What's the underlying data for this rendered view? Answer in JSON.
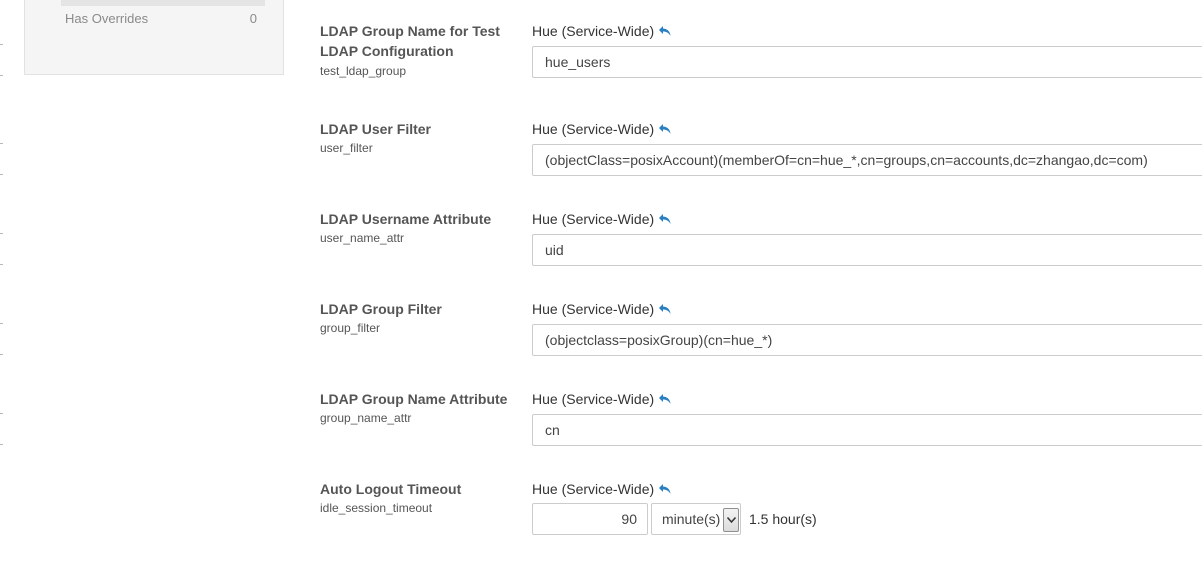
{
  "sidebar": {
    "filter_label": "Has Overrides",
    "filter_count": "0"
  },
  "rows": [
    {
      "title": "LDAP Group Name for Test LDAP Configuration",
      "key": "test_ldap_group",
      "scope": "Hue (Service-Wide)",
      "value": "hue_users"
    },
    {
      "title": "LDAP User Filter",
      "key": "user_filter",
      "scope": "Hue (Service-Wide)",
      "value": "(objectClass=posixAccount)(memberOf=cn=hue_*,cn=groups,cn=accounts,dc=zhangao,dc=com)"
    },
    {
      "title": "LDAP Username Attribute",
      "key": "user_name_attr",
      "scope": "Hue (Service-Wide)",
      "value": "uid"
    },
    {
      "title": "LDAP Group Filter",
      "key": "group_filter",
      "scope": "Hue (Service-Wide)",
      "value": "(objectclass=posixGroup)(cn=hue_*)"
    },
    {
      "title": "LDAP Group Name Attribute",
      "key": "group_name_attr",
      "scope": "Hue (Service-Wide)",
      "value": "cn"
    },
    {
      "title": "Auto Logout Timeout",
      "key": "idle_session_timeout",
      "scope": "Hue (Service-Wide)",
      "value": "90",
      "unit": "minute(s)",
      "converted": "1.5 hour(s)"
    }
  ],
  "colors": {
    "undo_icon": "#2a7fc1",
    "label": "#555555",
    "border": "#cccccc"
  },
  "icons": {
    "revert": "undo-arrow-icon",
    "dropdown": "chevron-down-icon"
  }
}
